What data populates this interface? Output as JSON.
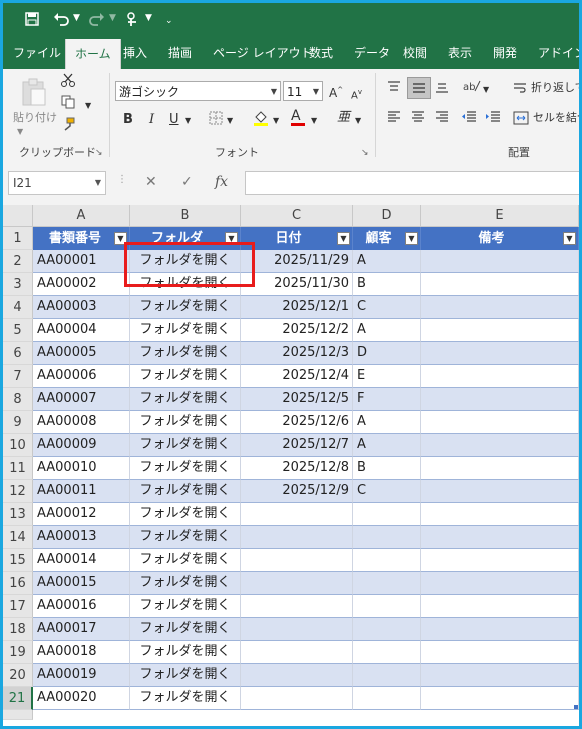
{
  "quick_access": {
    "save_icon": "save-icon",
    "undo_icon": "undo-icon",
    "redo_icon": "redo-icon",
    "touch_icon": "touch-mode-icon",
    "customize_icon": "customize-icon"
  },
  "tabs": [
    "ファイル",
    "ホーム",
    "挿入",
    "描画",
    "ページ レイアウト",
    "数式",
    "データ",
    "校閲",
    "表示",
    "開発",
    "アドイン"
  ],
  "ribbon": {
    "clipboard": {
      "paste_label": "貼り付け",
      "group_label": "クリップボード"
    },
    "font": {
      "font_name": "游ゴシック",
      "font_size": "11",
      "bold": "B",
      "italic": "I",
      "underline": "U",
      "group_label": "フォント"
    },
    "alignment": {
      "wrap_text": "折り返して",
      "merge": "セルを結合",
      "group_label": "配置"
    }
  },
  "formula_bar": {
    "name_box": "I21",
    "fx": "fx",
    "content": ""
  },
  "columns": [
    "A",
    "B",
    "C",
    "D",
    "E"
  ],
  "table_headers": [
    "書類番号",
    "フォルダ",
    "日付",
    "顧客",
    "備考"
  ],
  "rows": [
    {
      "num": "2",
      "id": "AA00001",
      "folder": "フォルダを開く",
      "date": "2025/11/29",
      "customer": "A"
    },
    {
      "num": "3",
      "id": "AA00002",
      "folder": "フォルダを開く",
      "date": "2025/11/30",
      "customer": "B"
    },
    {
      "num": "4",
      "id": "AA00003",
      "folder": "フォルダを開く",
      "date": "2025/12/1",
      "customer": "C"
    },
    {
      "num": "5",
      "id": "AA00004",
      "folder": "フォルダを開く",
      "date": "2025/12/2",
      "customer": "A"
    },
    {
      "num": "6",
      "id": "AA00005",
      "folder": "フォルダを開く",
      "date": "2025/12/3",
      "customer": "D"
    },
    {
      "num": "7",
      "id": "AA00006",
      "folder": "フォルダを開く",
      "date": "2025/12/4",
      "customer": "E"
    },
    {
      "num": "8",
      "id": "AA00007",
      "folder": "フォルダを開く",
      "date": "2025/12/5",
      "customer": "F"
    },
    {
      "num": "9",
      "id": "AA00008",
      "folder": "フォルダを開く",
      "date": "2025/12/6",
      "customer": "A"
    },
    {
      "num": "10",
      "id": "AA00009",
      "folder": "フォルダを開く",
      "date": "2025/12/7",
      "customer": "A"
    },
    {
      "num": "11",
      "id": "AA00010",
      "folder": "フォルダを開く",
      "date": "2025/12/8",
      "customer": "B"
    },
    {
      "num": "12",
      "id": "AA00011",
      "folder": "フォルダを開く",
      "date": "2025/12/9",
      "customer": "C"
    },
    {
      "num": "13",
      "id": "AA00012",
      "folder": "フォルダを開く",
      "date": "",
      "customer": ""
    },
    {
      "num": "14",
      "id": "AA00013",
      "folder": "フォルダを開く",
      "date": "",
      "customer": ""
    },
    {
      "num": "15",
      "id": "AA00014",
      "folder": "フォルダを開く",
      "date": "",
      "customer": ""
    },
    {
      "num": "16",
      "id": "AA00015",
      "folder": "フォルダを開く",
      "date": "",
      "customer": ""
    },
    {
      "num": "17",
      "id": "AA00016",
      "folder": "フォルダを開く",
      "date": "",
      "customer": ""
    },
    {
      "num": "18",
      "id": "AA00017",
      "folder": "フォルダを開く",
      "date": "",
      "customer": ""
    },
    {
      "num": "19",
      "id": "AA00018",
      "folder": "フォルダを開く",
      "date": "",
      "customer": ""
    },
    {
      "num": "20",
      "id": "AA00019",
      "folder": "フォルダを開く",
      "date": "",
      "customer": ""
    },
    {
      "num": "21",
      "id": "AA00020",
      "folder": "フォルダを開く",
      "date": "",
      "customer": ""
    }
  ],
  "colors": {
    "excel_green": "#217346",
    "table_header": "#4472c4",
    "band": "#d9e1f2",
    "highlight": "#e81c1c"
  }
}
